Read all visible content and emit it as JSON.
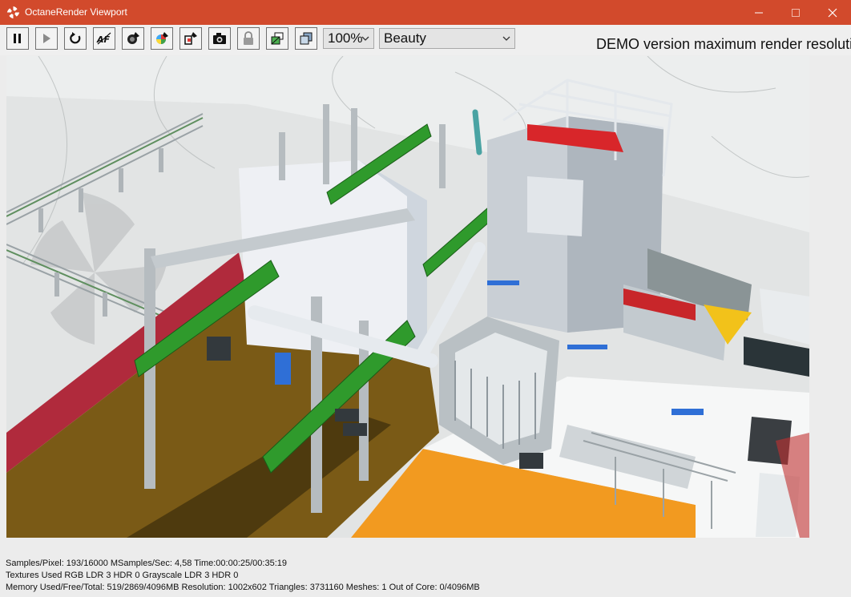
{
  "window": {
    "title": "OctaneRender Viewport",
    "accent_color": "#d24a2c"
  },
  "toolbar": {
    "buttons": [
      {
        "name": "pause",
        "icon": "pause-icon"
      },
      {
        "name": "start",
        "icon": "play-icon"
      },
      {
        "name": "restart",
        "icon": "restart-icon"
      },
      {
        "name": "autofocus",
        "icon": "autofocus-icon"
      },
      {
        "name": "pick-focus",
        "icon": "pick-focus-icon"
      },
      {
        "name": "pick-material",
        "icon": "color-picker-icon"
      },
      {
        "name": "pick-object",
        "icon": "object-picker-icon"
      },
      {
        "name": "save-render",
        "icon": "camera-icon"
      },
      {
        "name": "lock-viewport",
        "icon": "lock-icon"
      },
      {
        "name": "region-render",
        "icon": "region-icon"
      },
      {
        "name": "clay-mode",
        "icon": "layers-icon"
      }
    ],
    "zoom": {
      "value": "100%"
    },
    "render_pass": {
      "value": "Beauty"
    },
    "demo_notice": "DEMO version maximum render resolution"
  },
  "status": {
    "line1": "Samples/Pixel: 193/16000  MSamples/Sec: 4,58  Time:00:00:25/00:35:19",
    "line2": "Textures Used RGB LDR 3  HDR 0  Grayscale LDR 3  HDR 0",
    "line3": "Memory Used/Free/Total: 519/2869/4096MB  Resolution: 1002x602  Triangles: 3731160  Meshes:  1 Out of Core: 0/4096MB"
  }
}
